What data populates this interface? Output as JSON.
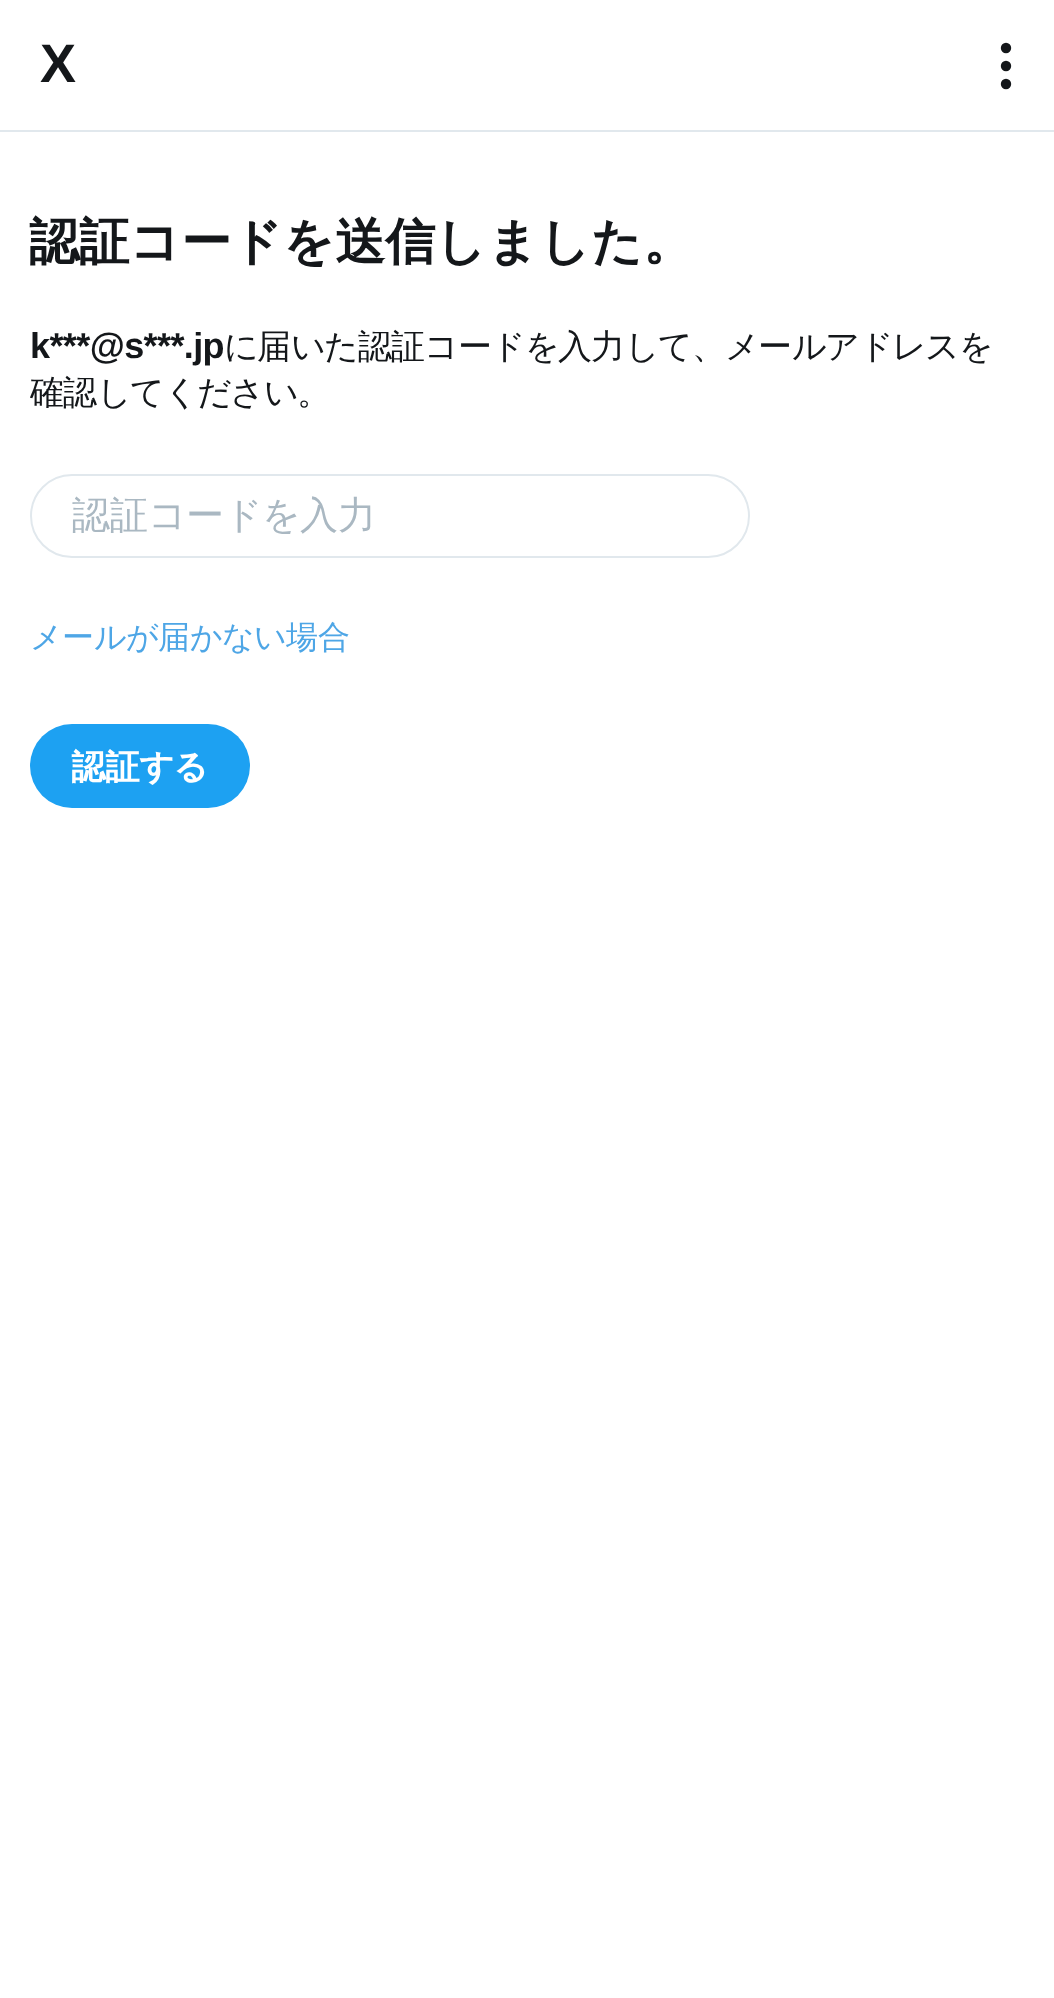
{
  "header": {
    "logo": "X"
  },
  "title": "認証コードを送信しました。",
  "message": {
    "email": "k***@s***.jp",
    "text": "に届いた認証コードを入力して、メールアドレスを確認してください。"
  },
  "code_field": {
    "placeholder": "認証コードを入力"
  },
  "help_link": "メールが届かない場合",
  "submit_button": "認証する"
}
